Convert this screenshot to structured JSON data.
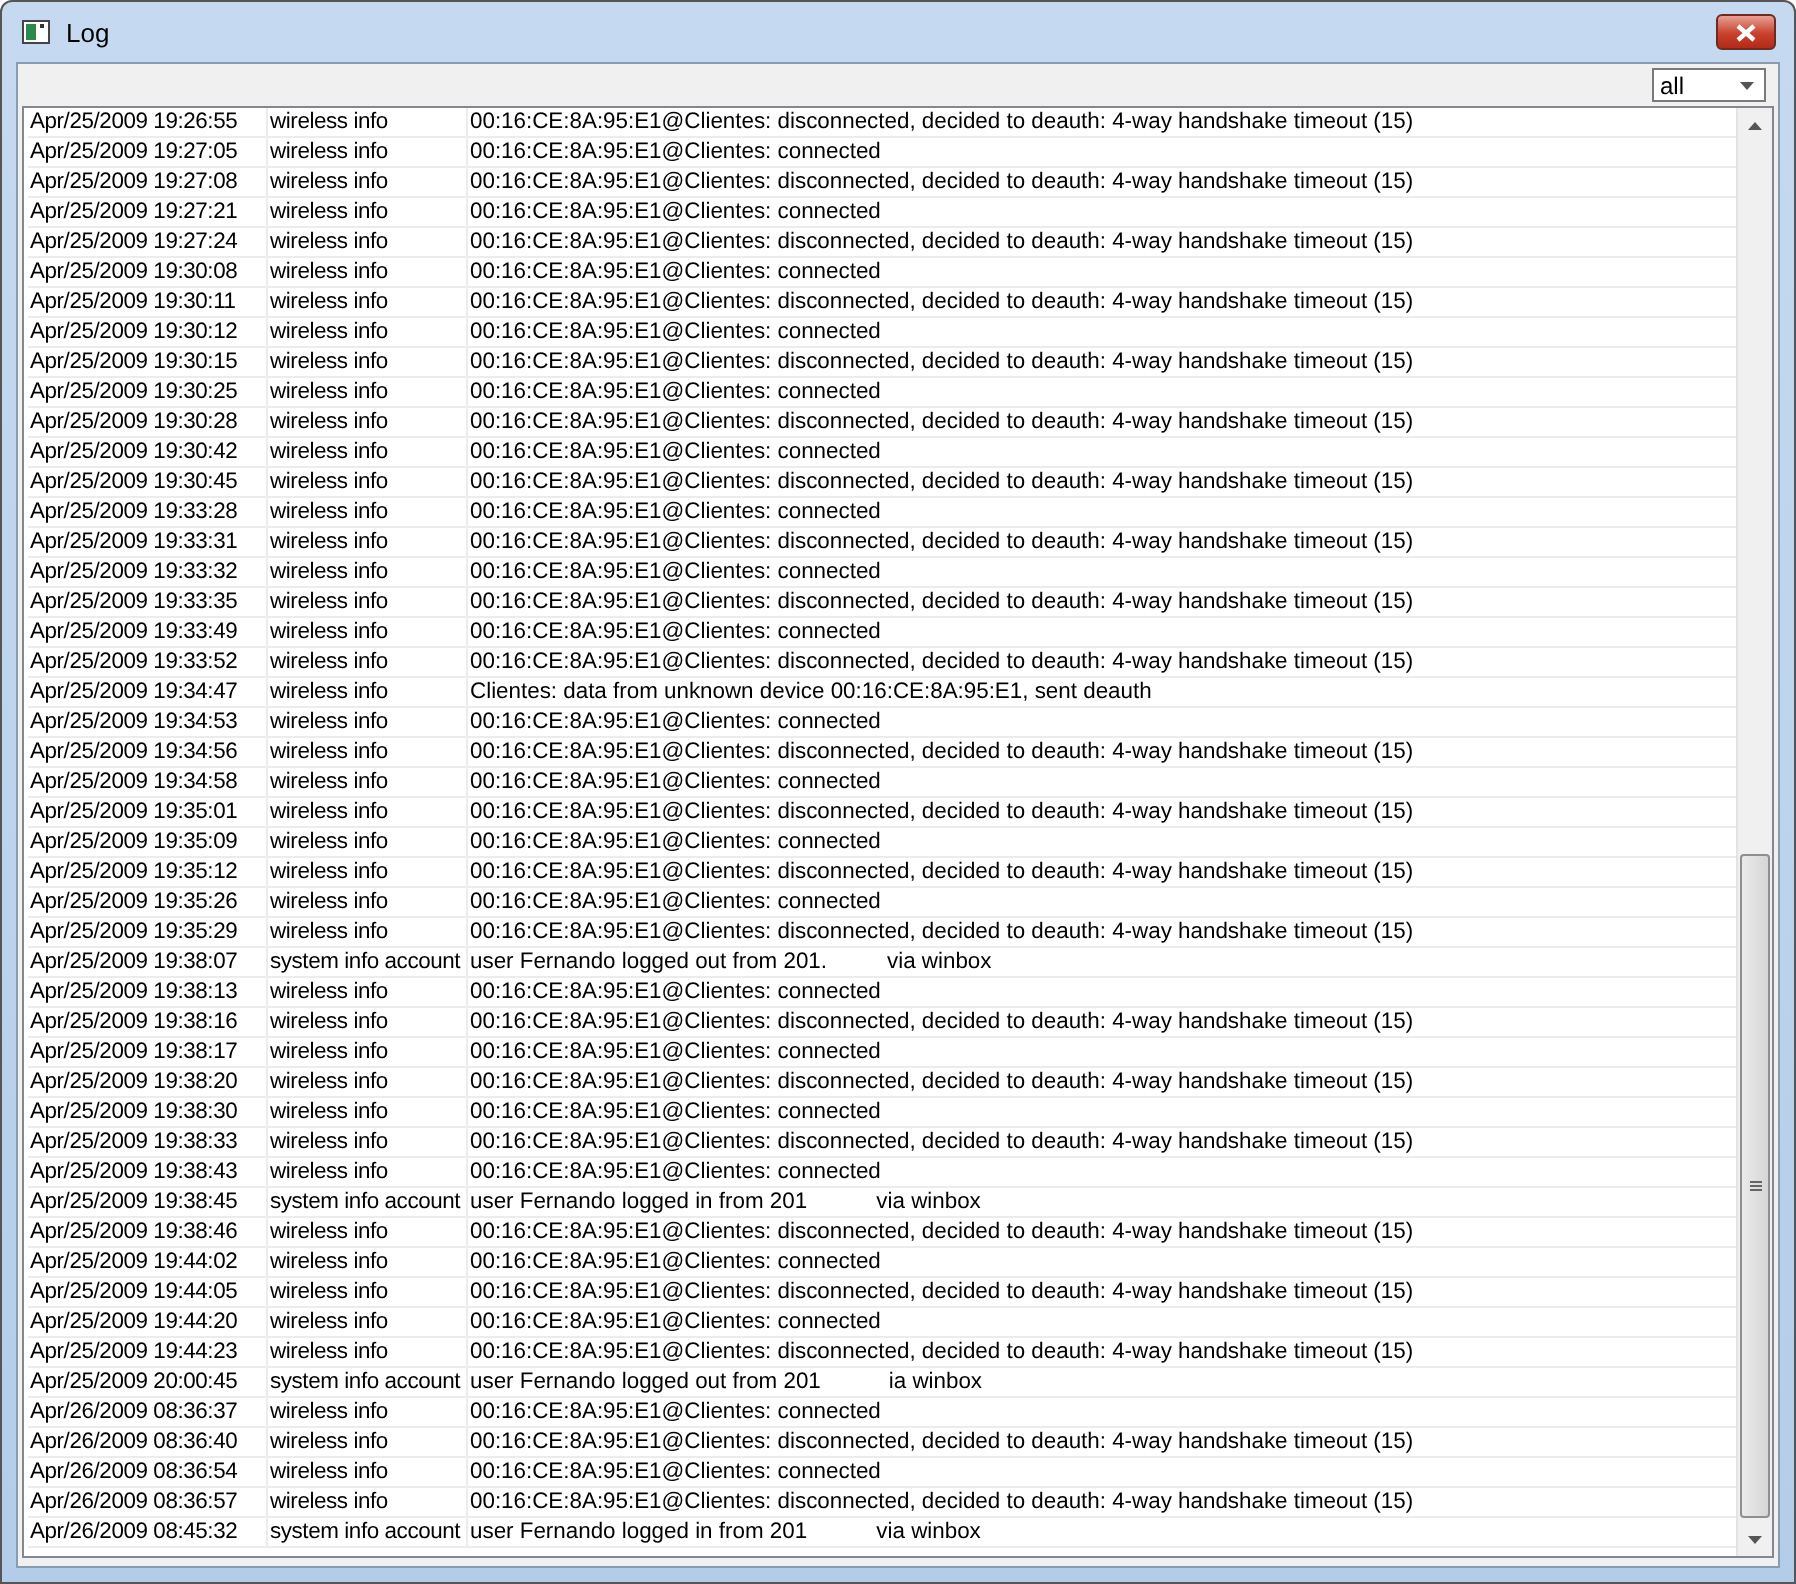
{
  "window": {
    "title": "Log"
  },
  "filter": {
    "value": "all"
  },
  "rows": [
    {
      "time": "Apr/25/2009 19:26:55",
      "topic": "wireless info",
      "message": "00:16:CE:8A:95:E1@Clientes: disconnected, decided to deauth: 4-way handshake timeout (15)"
    },
    {
      "time": "Apr/25/2009 19:27:05",
      "topic": "wireless info",
      "message": "00:16:CE:8A:95:E1@Clientes: connected"
    },
    {
      "time": "Apr/25/2009 19:27:08",
      "topic": "wireless info",
      "message": "00:16:CE:8A:95:E1@Clientes: disconnected, decided to deauth: 4-way handshake timeout (15)"
    },
    {
      "time": "Apr/25/2009 19:27:21",
      "topic": "wireless info",
      "message": "00:16:CE:8A:95:E1@Clientes: connected"
    },
    {
      "time": "Apr/25/2009 19:27:24",
      "topic": "wireless info",
      "message": "00:16:CE:8A:95:E1@Clientes: disconnected, decided to deauth: 4-way handshake timeout (15)"
    },
    {
      "time": "Apr/25/2009 19:30:08",
      "topic": "wireless info",
      "message": "00:16:CE:8A:95:E1@Clientes: connected"
    },
    {
      "time": "Apr/25/2009 19:30:11",
      "topic": "wireless info",
      "message": "00:16:CE:8A:95:E1@Clientes: disconnected, decided to deauth: 4-way handshake timeout (15)"
    },
    {
      "time": "Apr/25/2009 19:30:12",
      "topic": "wireless info",
      "message": "00:16:CE:8A:95:E1@Clientes: connected"
    },
    {
      "time": "Apr/25/2009 19:30:15",
      "topic": "wireless info",
      "message": "00:16:CE:8A:95:E1@Clientes: disconnected, decided to deauth: 4-way handshake timeout (15)"
    },
    {
      "time": "Apr/25/2009 19:30:25",
      "topic": "wireless info",
      "message": "00:16:CE:8A:95:E1@Clientes: connected"
    },
    {
      "time": "Apr/25/2009 19:30:28",
      "topic": "wireless info",
      "message": "00:16:CE:8A:95:E1@Clientes: disconnected, decided to deauth: 4-way handshake timeout (15)"
    },
    {
      "time": "Apr/25/2009 19:30:42",
      "topic": "wireless info",
      "message": "00:16:CE:8A:95:E1@Clientes: connected"
    },
    {
      "time": "Apr/25/2009 19:30:45",
      "topic": "wireless info",
      "message": "00:16:CE:8A:95:E1@Clientes: disconnected, decided to deauth: 4-way handshake timeout (15)"
    },
    {
      "time": "Apr/25/2009 19:33:28",
      "topic": "wireless info",
      "message": "00:16:CE:8A:95:E1@Clientes: connected"
    },
    {
      "time": "Apr/25/2009 19:33:31",
      "topic": "wireless info",
      "message": "00:16:CE:8A:95:E1@Clientes: disconnected, decided to deauth: 4-way handshake timeout (15)"
    },
    {
      "time": "Apr/25/2009 19:33:32",
      "topic": "wireless info",
      "message": "00:16:CE:8A:95:E1@Clientes: connected"
    },
    {
      "time": "Apr/25/2009 19:33:35",
      "topic": "wireless info",
      "message": "00:16:CE:8A:95:E1@Clientes: disconnected, decided to deauth: 4-way handshake timeout (15)"
    },
    {
      "time": "Apr/25/2009 19:33:49",
      "topic": "wireless info",
      "message": "00:16:CE:8A:95:E1@Clientes: connected"
    },
    {
      "time": "Apr/25/2009 19:33:52",
      "topic": "wireless info",
      "message": "00:16:CE:8A:95:E1@Clientes: disconnected, decided to deauth: 4-way handshake timeout (15)"
    },
    {
      "time": "Apr/25/2009 19:34:47",
      "topic": "wireless info",
      "message": "Clientes: data from unknown device 00:16:CE:8A:95:E1, sent deauth"
    },
    {
      "time": "Apr/25/2009 19:34:53",
      "topic": "wireless info",
      "message": "00:16:CE:8A:95:E1@Clientes: connected"
    },
    {
      "time": "Apr/25/2009 19:34:56",
      "topic": "wireless info",
      "message": "00:16:CE:8A:95:E1@Clientes: disconnected, decided to deauth: 4-way handshake timeout (15)"
    },
    {
      "time": "Apr/25/2009 19:34:58",
      "topic": "wireless info",
      "message": "00:16:CE:8A:95:E1@Clientes: connected"
    },
    {
      "time": "Apr/25/2009 19:35:01",
      "topic": "wireless info",
      "message": "00:16:CE:8A:95:E1@Clientes: disconnected, decided to deauth: 4-way handshake timeout (15)"
    },
    {
      "time": "Apr/25/2009 19:35:09",
      "topic": "wireless info",
      "message": "00:16:CE:8A:95:E1@Clientes: connected"
    },
    {
      "time": "Apr/25/2009 19:35:12",
      "topic": "wireless info",
      "message": "00:16:CE:8A:95:E1@Clientes: disconnected, decided to deauth: 4-way handshake timeout (15)"
    },
    {
      "time": "Apr/25/2009 19:35:26",
      "topic": "wireless info",
      "message": "00:16:CE:8A:95:E1@Clientes: connected"
    },
    {
      "time": "Apr/25/2009 19:35:29",
      "topic": "wireless info",
      "message": "00:16:CE:8A:95:E1@Clientes: disconnected, decided to deauth: 4-way handshake timeout (15)"
    },
    {
      "time": "Apr/25/2009 19:38:07",
      "topic": "system info account",
      "message": "user Fernando logged out from 201.",
      "tail": "via winbox"
    },
    {
      "time": "Apr/25/2009 19:38:13",
      "topic": "wireless info",
      "message": "00:16:CE:8A:95:E1@Clientes: connected"
    },
    {
      "time": "Apr/25/2009 19:38:16",
      "topic": "wireless info",
      "message": "00:16:CE:8A:95:E1@Clientes: disconnected, decided to deauth: 4-way handshake timeout (15)"
    },
    {
      "time": "Apr/25/2009 19:38:17",
      "topic": "wireless info",
      "message": "00:16:CE:8A:95:E1@Clientes: connected"
    },
    {
      "time": "Apr/25/2009 19:38:20",
      "topic": "wireless info",
      "message": "00:16:CE:8A:95:E1@Clientes: disconnected, decided to deauth: 4-way handshake timeout (15)"
    },
    {
      "time": "Apr/25/2009 19:38:30",
      "topic": "wireless info",
      "message": "00:16:CE:8A:95:E1@Clientes: connected"
    },
    {
      "time": "Apr/25/2009 19:38:33",
      "topic": "wireless info",
      "message": "00:16:CE:8A:95:E1@Clientes: disconnected, decided to deauth: 4-way handshake timeout (15)"
    },
    {
      "time": "Apr/25/2009 19:38:43",
      "topic": "wireless info",
      "message": "00:16:CE:8A:95:E1@Clientes: connected"
    },
    {
      "time": "Apr/25/2009 19:38:45",
      "topic": "system info account",
      "message": "user Fernando logged in from 201",
      "tail": "via winbox"
    },
    {
      "time": "Apr/25/2009 19:38:46",
      "topic": "wireless info",
      "message": "00:16:CE:8A:95:E1@Clientes: disconnected, decided to deauth: 4-way handshake timeout (15)"
    },
    {
      "time": "Apr/25/2009 19:44:02",
      "topic": "wireless info",
      "message": "00:16:CE:8A:95:E1@Clientes: connected"
    },
    {
      "time": "Apr/25/2009 19:44:05",
      "topic": "wireless info",
      "message": "00:16:CE:8A:95:E1@Clientes: disconnected, decided to deauth: 4-way handshake timeout (15)"
    },
    {
      "time": "Apr/25/2009 19:44:20",
      "topic": "wireless info",
      "message": "00:16:CE:8A:95:E1@Clientes: connected"
    },
    {
      "time": "Apr/25/2009 19:44:23",
      "topic": "wireless info",
      "message": "00:16:CE:8A:95:E1@Clientes: disconnected, decided to deauth: 4-way handshake timeout (15)"
    },
    {
      "time": "Apr/25/2009 20:00:45",
      "topic": "system info account",
      "message": "user Fernando logged out from 201",
      "tail": "ia winbox"
    },
    {
      "time": "Apr/26/2009 08:36:37",
      "topic": "wireless info",
      "message": "00:16:CE:8A:95:E1@Clientes: connected"
    },
    {
      "time": "Apr/26/2009 08:36:40",
      "topic": "wireless info",
      "message": "00:16:CE:8A:95:E1@Clientes: disconnected, decided to deauth: 4-way handshake timeout (15)"
    },
    {
      "time": "Apr/26/2009 08:36:54",
      "topic": "wireless info",
      "message": "00:16:CE:8A:95:E1@Clientes: connected"
    },
    {
      "time": "Apr/26/2009 08:36:57",
      "topic": "wireless info",
      "message": "00:16:CE:8A:95:E1@Clientes: disconnected, decided to deauth: 4-way handshake timeout (15)"
    },
    {
      "time": "Apr/26/2009 08:45:32",
      "topic": "system info account",
      "message": "user Fernando logged in from 201",
      "tail": "via winbox"
    }
  ]
}
